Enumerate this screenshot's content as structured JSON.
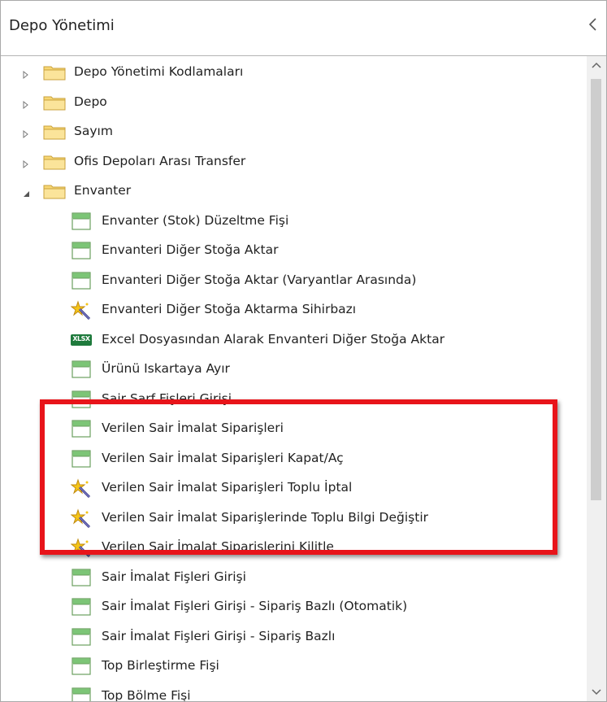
{
  "panel": {
    "title": "Depo Yönetimi",
    "collapse_icon": "chevron-left-icon"
  },
  "tree": {
    "folders": [
      {
        "label": "Depo Yönetimi Kodlamaları",
        "expanded": false
      },
      {
        "label": "Depo",
        "expanded": false
      },
      {
        "label": "Sayım",
        "expanded": false
      },
      {
        "label": "Ofis Depoları Arası Transfer",
        "expanded": false
      },
      {
        "label": "Envanter",
        "expanded": true
      }
    ],
    "items": [
      {
        "label": "Envanter (Stok) Düzeltme Fişi",
        "icon": "form-icon"
      },
      {
        "label": "Envanteri Diğer Stoğa Aktar",
        "icon": "form-icon"
      },
      {
        "label": "Envanteri Diğer Stoğa Aktar (Varyantlar Arasında)",
        "icon": "form-icon"
      },
      {
        "label": "Envanteri Diğer Stoğa Aktarma Sihirbazı",
        "icon": "wizard-icon"
      },
      {
        "label": "Excel Dosyasından Alarak Envanteri Diğer Stoğa Aktar",
        "icon": "excel-icon",
        "icon_text": "XLSX"
      },
      {
        "label": "Ürünü Iskartaya Ayır",
        "icon": "form-icon"
      },
      {
        "label": "Sair Sarf Fişleri Girişi",
        "icon": "form-icon"
      },
      {
        "label": "Verilen Sair İmalat Siparişleri",
        "icon": "form-icon"
      },
      {
        "label": "Verilen Sair İmalat Siparişleri Kapat/Aç",
        "icon": "form-icon"
      },
      {
        "label": "Verilen Sair İmalat Siparişleri Toplu İptal",
        "icon": "wizard-icon"
      },
      {
        "label": "Verilen Sair İmalat Siparişlerinde Toplu Bilgi Değiştir",
        "icon": "wizard-icon"
      },
      {
        "label": "Verilen Sair İmalat Siparişlerini Kilitle",
        "icon": "wizard-icon"
      },
      {
        "label": "Sair İmalat Fişleri Girişi",
        "icon": "form-icon"
      },
      {
        "label": "Sair İmalat Fişleri Girişi - Sipariş Bazlı (Otomatik)",
        "icon": "form-icon"
      },
      {
        "label": "Sair İmalat Fişleri Girişi - Sipariş Bazlı",
        "icon": "form-icon"
      },
      {
        "label": "Top Birleştirme Fişi",
        "icon": "form-icon"
      },
      {
        "label": "Top Bölme Fişi",
        "icon": "form-icon"
      }
    ]
  },
  "colors": {
    "highlight_border": "#e8141a",
    "folder_fill": "#f7d774",
    "form_icon_header": "#7cc576",
    "scrollbar_thumb": "#cdcdcd"
  }
}
